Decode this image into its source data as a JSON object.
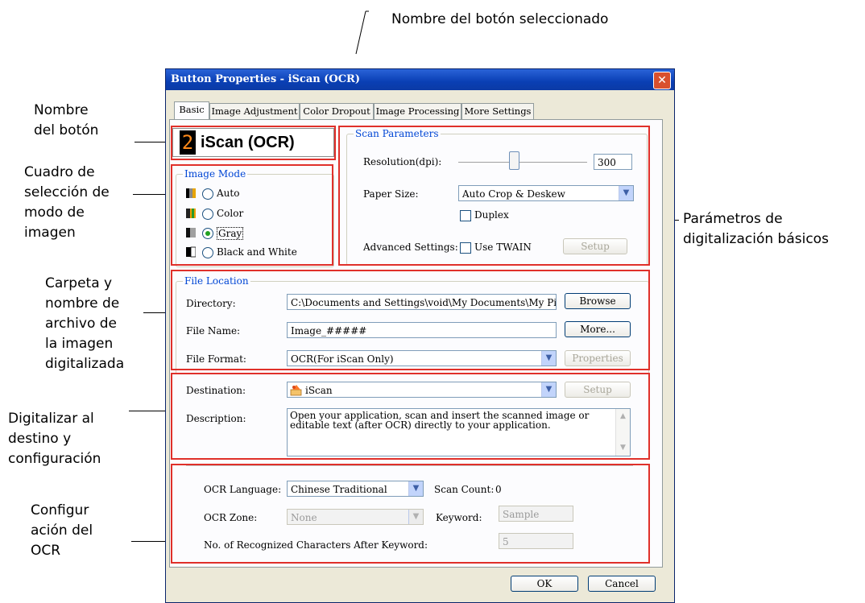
{
  "annotations": {
    "selected_button_name": "Nombre del botón seleccionado",
    "button_name": [
      "Nombre",
      "del botón"
    ],
    "image_mode_box": [
      "Cuadro de",
      "selección de",
      "modo de",
      "imagen"
    ],
    "basic_params": [
      "Parámetros de",
      "digitalización básicos"
    ],
    "file_location": [
      "Carpeta y",
      "nombre de",
      "archivo de",
      "la imagen",
      "digitalizada"
    ],
    "destination": [
      "Digitalizar al",
      "destino y",
      "configuración"
    ],
    "ocr_settings": [
      "Configur",
      "ación del",
      "OCR"
    ]
  },
  "window": {
    "title": "Button Properties - iScan (OCR)",
    "close": "✕"
  },
  "tabs": [
    "Basic",
    "Image Adjustment",
    "Color Dropout",
    "Image Processing",
    "More Settings"
  ],
  "button_badge": {
    "number": "2",
    "name": "iScan (OCR)"
  },
  "image_mode": {
    "legend": "Image Mode",
    "options": [
      "Auto",
      "Color",
      "Gray",
      "Black and White"
    ],
    "selected": "Gray"
  },
  "scan_parameters": {
    "legend": "Scan Parameters",
    "resolution_label": "Resolution(dpi):",
    "resolution_value": "300",
    "resolution_slider_fraction": 0.42,
    "paper_size_label": "Paper Size:",
    "paper_size_value": "Auto Crop & Deskew",
    "duplex_label": "Duplex",
    "advanced_label": "Advanced Settings:",
    "use_twain_label": "Use TWAIN",
    "setup_label": "Setup"
  },
  "file_location": {
    "legend": "File Location",
    "directory_label": "Directory:",
    "directory_value": "C:\\Documents and Settings\\void\\My Documents\\My Pictures",
    "browse_label": "Browse",
    "file_name_label": "File Name:",
    "file_name_value": "Image_#####",
    "more_label": "More...",
    "file_format_label": "File Format:",
    "file_format_value": "OCR(For iScan Only)",
    "properties_label": "Properties"
  },
  "destination": {
    "label": "Destination:",
    "value": "iScan",
    "setup_label": "Setup",
    "description_label": "Description:",
    "description_text": "Open your application, scan and insert the scanned image or editable text (after OCR) directly to your application."
  },
  "ocr": {
    "language_label": "OCR Language:",
    "language_value": "Chinese Traditional",
    "scan_count_label": "Scan Count:",
    "scan_count_value": "0",
    "zone_label": "OCR Zone:",
    "zone_value": "None",
    "keyword_label": "Keyword:",
    "keyword_value": "Sample",
    "chars_label": "No. of Recognized Characters After Keyword:",
    "chars_value": "5"
  },
  "footer": {
    "ok_label": "OK",
    "cancel_label": "Cancel"
  },
  "colors": {
    "highlight_red": "#e0302a",
    "title_blue": "#0a3fb4",
    "group_title_blue": "#0046d5"
  }
}
